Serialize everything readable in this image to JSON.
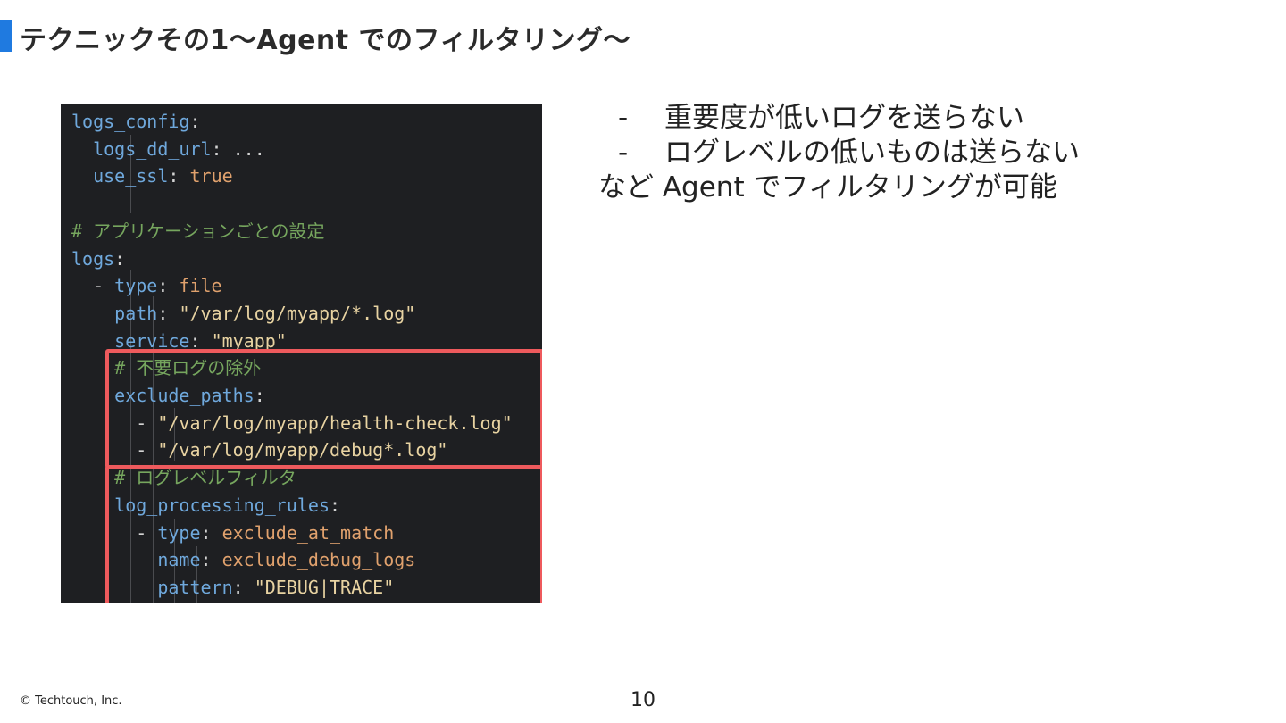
{
  "slide": {
    "title": "テクニックその1〜Agent でのフィルタリング〜",
    "accent_color": "#1f7ae0"
  },
  "code": {
    "lines": [
      [
        [
          "tok-key",
          "logs_config"
        ],
        [
          "tok-punc",
          ":"
        ]
      ],
      [
        [
          "tok-punc",
          "  "
        ],
        [
          "tok-key",
          "logs_dd_url"
        ],
        [
          "tok-punc",
          ": ..."
        ]
      ],
      [
        [
          "tok-punc",
          "  "
        ],
        [
          "tok-key",
          "use_ssl"
        ],
        [
          "tok-punc",
          ": "
        ],
        [
          "tok-val",
          "true"
        ]
      ],
      [],
      [
        [
          "tok-comment",
          "# アプリケーションごとの設定"
        ]
      ],
      [
        [
          "tok-key",
          "logs"
        ],
        [
          "tok-punc",
          ":"
        ]
      ],
      [
        [
          "tok-dash",
          "  - "
        ],
        [
          "tok-key",
          "type"
        ],
        [
          "tok-punc",
          ": "
        ],
        [
          "tok-val",
          "file"
        ]
      ],
      [
        [
          "tok-punc",
          "    "
        ],
        [
          "tok-key",
          "path"
        ],
        [
          "tok-punc",
          ": "
        ],
        [
          "tok-str",
          "\"/var/log/myapp/*.log\""
        ]
      ],
      [
        [
          "tok-punc",
          "    "
        ],
        [
          "tok-key",
          "service"
        ],
        [
          "tok-punc",
          ": "
        ],
        [
          "tok-str",
          "\"myapp\""
        ]
      ],
      [
        [
          "tok-punc",
          "    "
        ],
        [
          "tok-comment",
          "# 不要ログの除外"
        ]
      ],
      [
        [
          "tok-punc",
          "    "
        ],
        [
          "tok-key",
          "exclude_paths"
        ],
        [
          "tok-punc",
          ":"
        ]
      ],
      [
        [
          "tok-dash",
          "      - "
        ],
        [
          "tok-str",
          "\"/var/log/myapp/health-check.log\""
        ]
      ],
      [
        [
          "tok-dash",
          "      - "
        ],
        [
          "tok-str",
          "\"/var/log/myapp/debug*.log\""
        ]
      ],
      [
        [
          "tok-punc",
          "    "
        ],
        [
          "tok-comment",
          "# ログレベルフィルタ"
        ]
      ],
      [
        [
          "tok-punc",
          "    "
        ],
        [
          "tok-key",
          "log_processing_rules"
        ],
        [
          "tok-punc",
          ":"
        ]
      ],
      [
        [
          "tok-dash",
          "      - "
        ],
        [
          "tok-key",
          "type"
        ],
        [
          "tok-punc",
          ": "
        ],
        [
          "tok-val",
          "exclude_at_match"
        ]
      ],
      [
        [
          "tok-punc",
          "        "
        ],
        [
          "tok-key",
          "name"
        ],
        [
          "tok-punc",
          ": "
        ],
        [
          "tok-val",
          "exclude_debug_logs"
        ]
      ],
      [
        [
          "tok-punc",
          "        "
        ],
        [
          "tok-key",
          "pattern"
        ],
        [
          "tok-punc",
          ": "
        ],
        [
          "tok-str",
          "\"DEBUG|TRACE\""
        ]
      ]
    ],
    "highlight_color": "#ee5a5d"
  },
  "bullets": {
    "items": [
      {
        "dash": "-",
        "text": "重要度が低いログを送らない"
      },
      {
        "dash": "-",
        "text": "ログレベルの低いものは送らない"
      }
    ],
    "summary": "など Agent でフィルタリングが可能"
  },
  "footer": {
    "copyright": "© Techtouch, Inc.",
    "page_number": "10"
  }
}
